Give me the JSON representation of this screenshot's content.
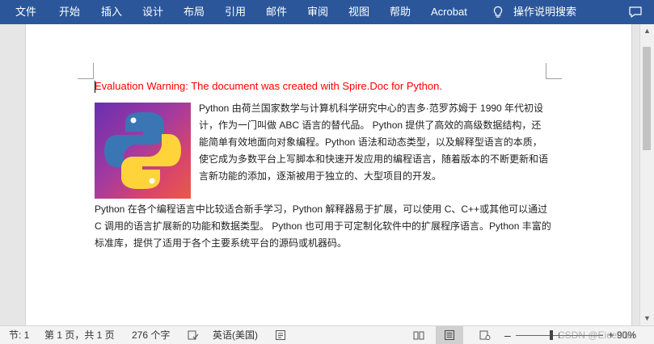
{
  "ribbon": {
    "tabs": [
      "文件",
      "开始",
      "插入",
      "设计",
      "布局",
      "引用",
      "邮件",
      "审阅",
      "视图",
      "帮助",
      "Acrobat"
    ],
    "tell_me": "操作说明搜索"
  },
  "document": {
    "warning": "Evaluation Warning: The document was created with Spire.Doc for Python.",
    "para1": "Python 由荷兰国家数学与计算机科学研究中心的吉多·范罗苏姆于 1990 年代初设计，作为一门叫做 ABC 语言的替代品。 Python 提供了高效的高级数据结构，还能简单有效地面向对象编程。Python 语法和动态类型，以及解释型语言的本质，使它成为多数平台上写脚本和快速开发应用的编程语言，随着版本的不断更新和语言新功能的添加，逐渐被用于独立的、大型项目的开发。",
    "para2": "Python 在各个编程语言中比较适合新手学习，Python 解释器易于扩展，可以使用 C、C++或其他可以通过 C 调用的语言扩展新的功能和数据类型。 Python 也可用于可定制化软件中的扩展程序语言。Python 丰富的标准库，提供了适用于各个主要系统平台的源码或机器码。"
  },
  "status": {
    "section": "节: 1",
    "page": "第 1 页，共 1 页",
    "words": "276 个字",
    "language": "英语(美国)",
    "zoom": "90%",
    "watermark": "CSDN @Eiceblue"
  },
  "colors": {
    "ribbon_bg": "#2b579a",
    "warning_text": "#ff0000"
  }
}
